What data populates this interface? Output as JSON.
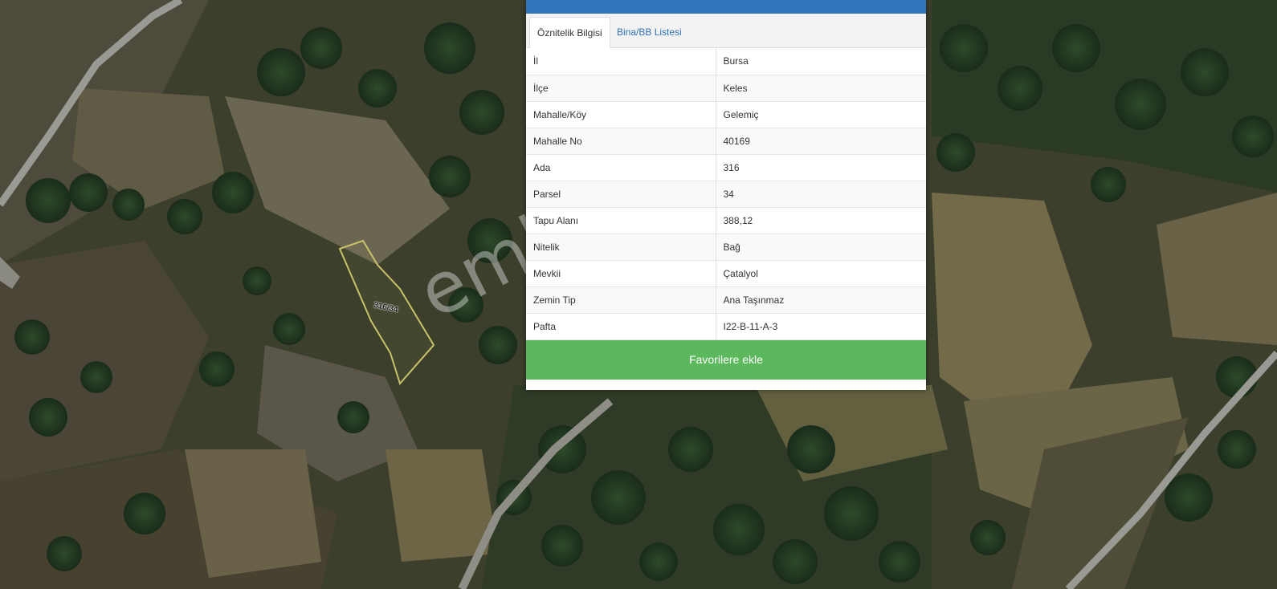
{
  "panel": {
    "tabs": [
      {
        "label": "Öznitelik Bilgisi",
        "active": true
      },
      {
        "label": "Bina/BB Listesi",
        "active": false
      }
    ],
    "rows": [
      {
        "key": "İl",
        "value": "Bursa"
      },
      {
        "key": "İlçe",
        "value": "Keles"
      },
      {
        "key": "Mahalle/Köy",
        "value": "Gelemiç"
      },
      {
        "key": "Mahalle No",
        "value": "40169"
      },
      {
        "key": "Ada",
        "value": "316"
      },
      {
        "key": "Parsel",
        "value": "34"
      },
      {
        "key": "Tapu Alanı",
        "value": "388,12"
      },
      {
        "key": "Nitelik",
        "value": "Bağ"
      },
      {
        "key": "Mevkii",
        "value": "Çatalyol"
      },
      {
        "key": "Zemin Tip",
        "value": "Ana Taşınmaz"
      },
      {
        "key": "Pafta",
        "value": "I22-B-11-A-3"
      }
    ],
    "favorite_button": "Favorilere ekle"
  },
  "map": {
    "parcel_label": "316/34",
    "watermark": "emlakjet.com",
    "colors": {
      "header": "#3075bb",
      "button": "#5cb85c",
      "parcel_outline": "#c8c36a",
      "road": "#9a9a94"
    }
  }
}
